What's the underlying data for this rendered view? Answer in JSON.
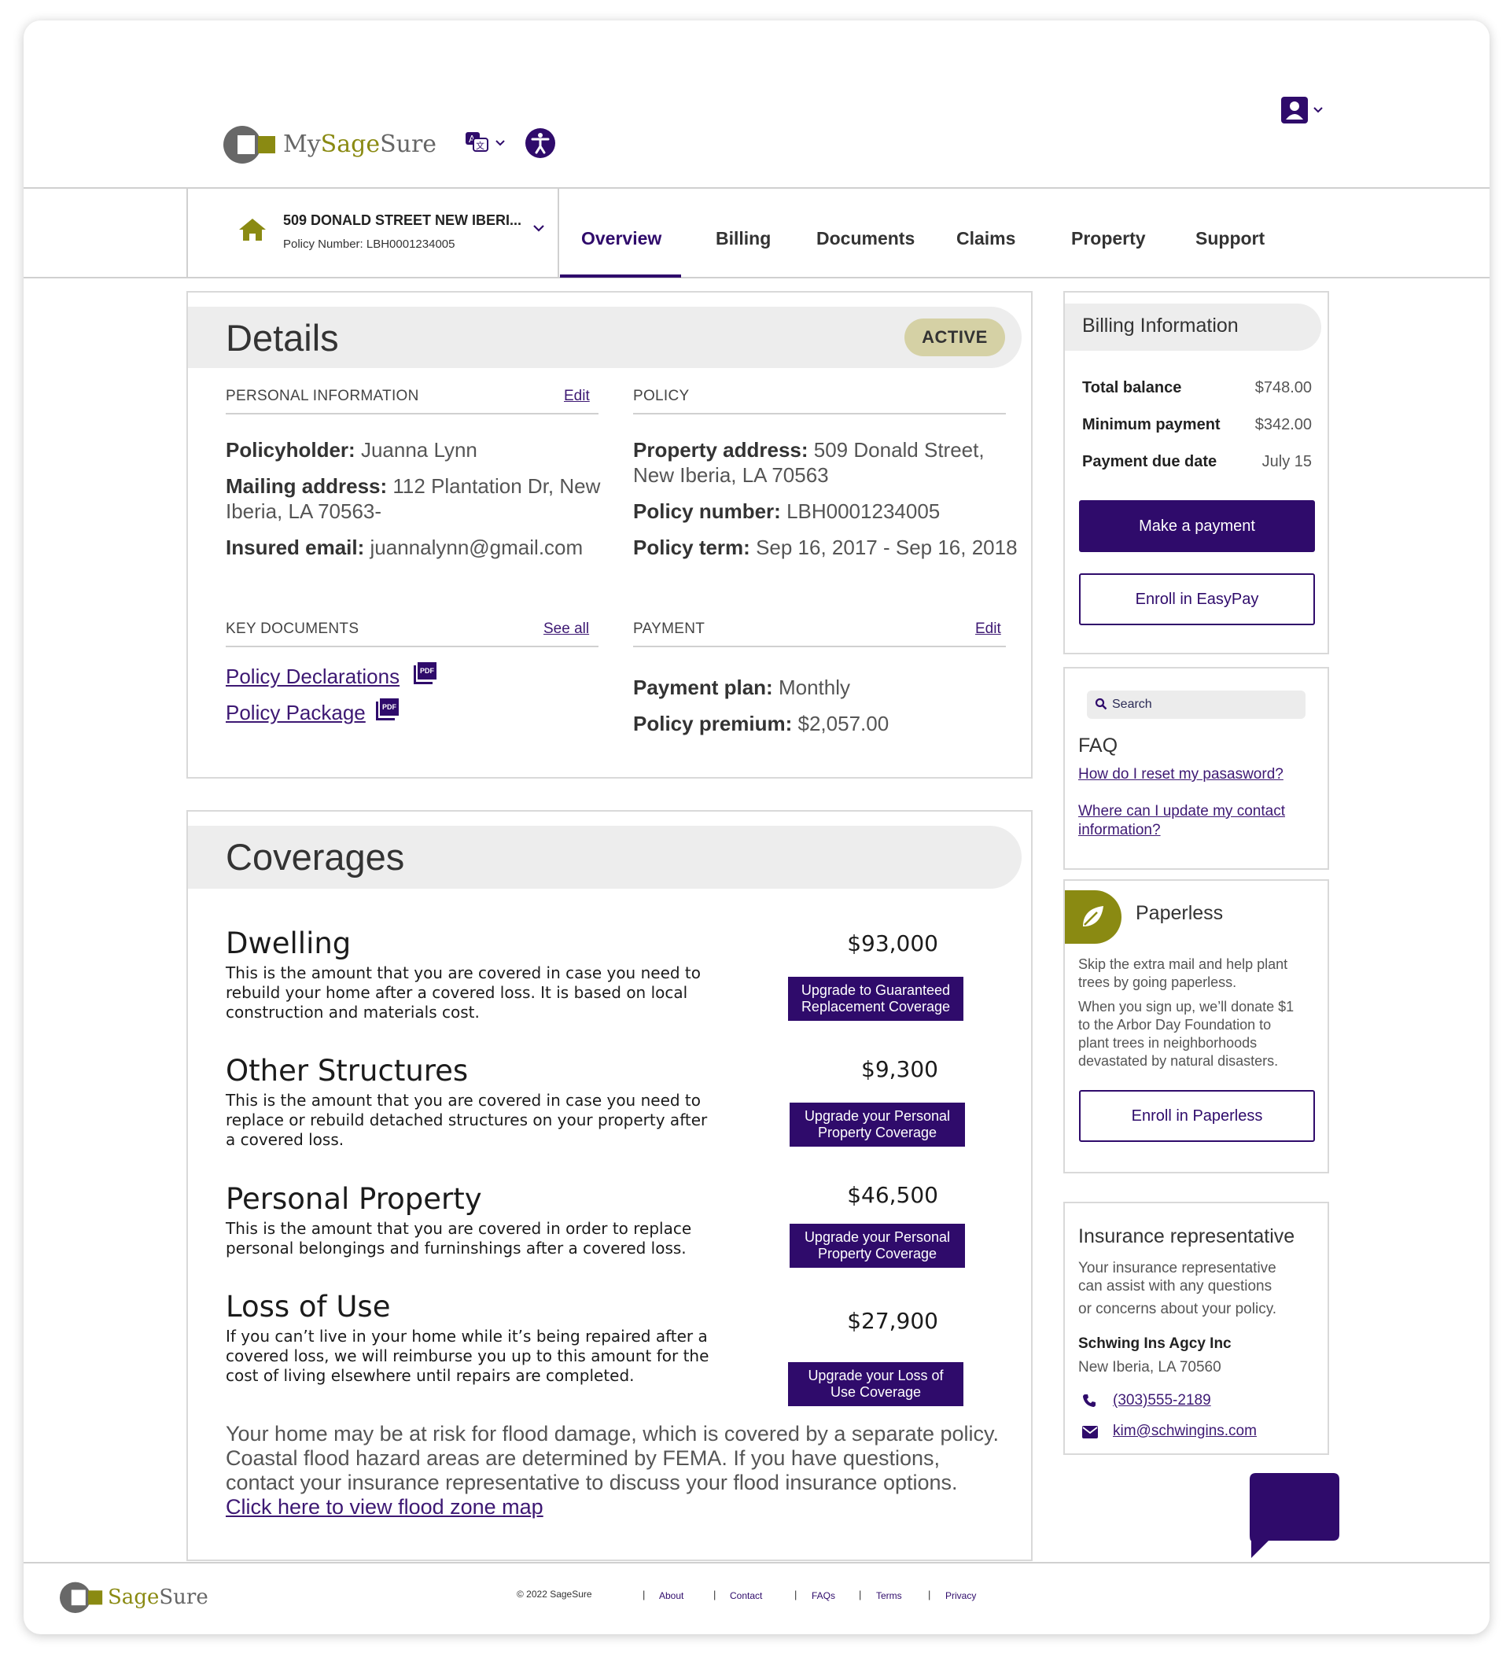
{
  "header": {
    "logo_text_my": "My",
    "logo_text_sage": "Sage",
    "logo_text_sure": "Sure",
    "icons": [
      "translate-icon",
      "accessibility-icon",
      "account-icon"
    ]
  },
  "policy_selector": {
    "address": "509 DONALD STREET NEW IBERI...",
    "policy_number": "Policy Number: LBH0001234005"
  },
  "tabs": [
    {
      "label": "Overview",
      "active": true
    },
    {
      "label": "Billing"
    },
    {
      "label": "Documents"
    },
    {
      "label": "Claims"
    },
    {
      "label": "Property"
    },
    {
      "label": "Support"
    }
  ],
  "details": {
    "title": "Details",
    "status": "ACTIVE",
    "personal": {
      "heading": "PERSONAL INFORMATION",
      "edit": "Edit",
      "policyholder_label": "Policyholder:",
      "policyholder": "Juanna Lynn",
      "mailing_label": "Mailing address:",
      "mailing_line1": "112 Plantation Dr, New",
      "mailing_line2": "Iberia, LA 70563-",
      "email_label": "Insured email:",
      "email": "juannalynn@gmail.com"
    },
    "policy": {
      "heading": "POLICY",
      "property_label": "Property address:",
      "property_line1": "509 Donald Street,",
      "property_line2": "New Iberia, LA 70563",
      "number_label": "Policy number:",
      "number": "LBH0001234005",
      "term_label": "Policy term:",
      "term": "Sep 16, 2017 - Sep 16, 2018"
    },
    "key_documents": {
      "heading": "KEY DOCUMENTS",
      "see_all": "See all",
      "docs": [
        "Policy Declarations",
        "Policy Package"
      ],
      "pdf_badge": "PDF"
    },
    "payment": {
      "heading": "PAYMENT",
      "edit": "Edit",
      "plan_label": "Payment plan:",
      "plan": "Monthly",
      "premium_label": "Policy premium:",
      "premium": "$2,057.00"
    }
  },
  "coverages": {
    "title": "Coverages",
    "items": [
      {
        "name": "Dwelling",
        "amount": "$93,000",
        "desc": [
          "This is the amount that you are covered in case you need to",
          "rebuild your home after a covered loss. It is based on local",
          "construction and materials cost."
        ],
        "button": [
          "Upgrade to Guaranteed",
          "Replacement Coverage"
        ]
      },
      {
        "name": "Other Structures",
        "amount": "$9,300",
        "desc": [
          "This is the amount that you are covered in case you need to",
          "replace or rebuild detached structures on your property after",
          "a covered loss."
        ],
        "button": [
          "Upgrade your Personal",
          "Property Coverage"
        ]
      },
      {
        "name": "Personal Property",
        "amount": "$46,500",
        "desc": [
          "This is the amount that you are covered in order to replace",
          "personal belongings and furninshings after a covered loss."
        ],
        "button": [
          "Upgrade your Personal",
          "Property Coverage"
        ]
      },
      {
        "name": "Loss of Use",
        "amount": "$27,900",
        "desc": [
          "If you can’t live in your home while it’s being repaired after a",
          "covered loss, we will reimburse you up to this amount for the",
          "cost of living elsewhere until repairs are completed."
        ],
        "button": [
          "Upgrade your Loss of",
          "Use Coverage"
        ]
      }
    ],
    "flood_text": [
      "Your home may be at risk for flood damage, which is covered by a separate policy.",
      "Coastal flood hazard areas are determined by FEMA. If you have questions,",
      "contact your insurance representative to discuss your flood insurance options."
    ],
    "flood_link": "Click here to view flood zone map"
  },
  "billing": {
    "title": "Billing Information",
    "rows": [
      {
        "label": "Total balance",
        "value": "$748.00"
      },
      {
        "label": "Minimum payment",
        "value": "$342.00"
      },
      {
        "label": "Payment due date",
        "value": "July 15"
      }
    ],
    "pay_button": "Make a payment",
    "easypay_button": "Enroll in EasyPay"
  },
  "faq": {
    "search_placeholder": "Search",
    "title": "FAQ",
    "q1": "How do I reset my pasasword?",
    "q2_line1": "Where can I update my contact",
    "q2_line2": "information?"
  },
  "paperless": {
    "title": "Paperless",
    "p1": [
      "Skip the extra mail and help plant",
      "trees by going paperless."
    ],
    "p2": [
      "When you sign up, we’ll donate $1",
      "to the Arbor Day Foundation to",
      "plant trees in neighborhoods",
      "devastated by natural disasters."
    ],
    "button": "Enroll in Paperless"
  },
  "rep": {
    "title": "Insurance representative",
    "desc": [
      "Your insurance representative",
      "can assist with any questions",
      "or concerns about your policy."
    ],
    "name": "Schwing Ins Agcy Inc",
    "location": "New Iberia, LA 70560",
    "phone": "(303)555-2189",
    "email": "kim@schwingins.com"
  },
  "footer": {
    "logo_sage": "Sage",
    "logo_sure": "Sure",
    "copyright": "© 2022 SageSure",
    "links": [
      "About",
      "Contact",
      "FAQs",
      "Terms",
      "Privacy"
    ],
    "separator": "|"
  },
  "colors": {
    "brand_purple": "#2f0b6b",
    "brand_olive": "#8a8a12",
    "logo_gray": "#666666",
    "banner_gray": "#ededed",
    "active_badge": "#d5d1a5"
  }
}
